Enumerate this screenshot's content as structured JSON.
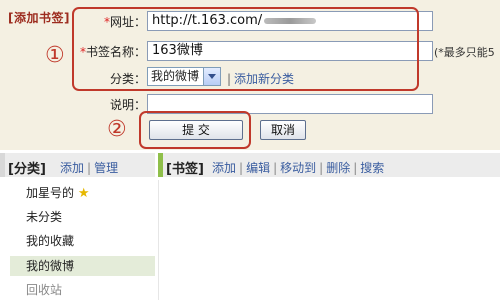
{
  "form": {
    "title": "[添加书签]",
    "url_label": "网址：",
    "url_value": "http://t.163.com/",
    "name_label": "书签名称：",
    "name_value": "163微博",
    "name_hint": "(*最多只能5",
    "category_label": "分类：",
    "category_value": "我的微博",
    "add_category_link": "添加新分类",
    "description_label": "说明：",
    "description_value": "",
    "submit_label": "提 交",
    "cancel_label": "取消",
    "callout_1": "①",
    "callout_2": "②"
  },
  "categories_panel": {
    "title": "[分类]",
    "actions": [
      "添加",
      "管理"
    ],
    "items": [
      {
        "label": "加星号的"
      },
      {
        "label": "未分类"
      },
      {
        "label": "我的收藏"
      },
      {
        "label": "我的微博"
      },
      {
        "label": "回收站"
      }
    ],
    "active_item": "我的微博"
  },
  "bookmarks_panel": {
    "title": "[书签]",
    "actions": [
      "添加",
      "编辑",
      "移动到",
      "删除",
      "搜索"
    ]
  },
  "colors": {
    "form_bg": "#f4f0e2",
    "callout": "#c0392b",
    "link": "#3a5da0",
    "bookmark_bar": "#8fbf4a"
  },
  "icons": [
    "star-icon",
    "dropdown-arrow-icon"
  ]
}
